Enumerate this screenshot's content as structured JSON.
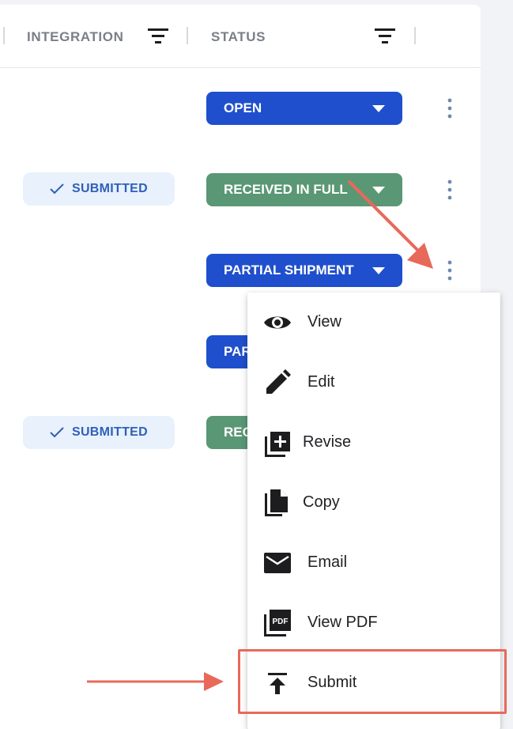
{
  "header": {
    "integration_label": "INTEGRATION",
    "status_label": "STATUS"
  },
  "rows": [
    {
      "integration": "",
      "status": "OPEN",
      "status_color": "#1f4fcc"
    },
    {
      "integration": "SUBMITTED",
      "status": "RECEIVED IN FULL",
      "status_color": "#5a9775"
    },
    {
      "integration": "",
      "status": "PARTIAL SHIPMENT",
      "status_color": "#1f4fcc"
    },
    {
      "integration": "",
      "status": "PAR",
      "status_color": "#1f4fcc"
    },
    {
      "integration": "SUBMITTED",
      "status": "REC",
      "status_color": "#5a9775"
    }
  ],
  "menu": {
    "items": [
      {
        "label": "View",
        "icon": "eye-icon"
      },
      {
        "label": "Edit",
        "icon": "pencil-icon"
      },
      {
        "label": "Revise",
        "icon": "library-add-icon"
      },
      {
        "label": "Copy",
        "icon": "file-copy-icon"
      },
      {
        "label": "Email",
        "icon": "mail-icon"
      },
      {
        "label": "View PDF",
        "icon": "pdf-icon"
      },
      {
        "label": "Submit",
        "icon": "upload-icon"
      }
    ]
  },
  "colors": {
    "blue_status": "#1f4fcc",
    "green_status": "#5a9775",
    "badge_bg": "#e8f1fc",
    "badge_text": "#2f5fb8",
    "annotation": "#e8695a"
  }
}
